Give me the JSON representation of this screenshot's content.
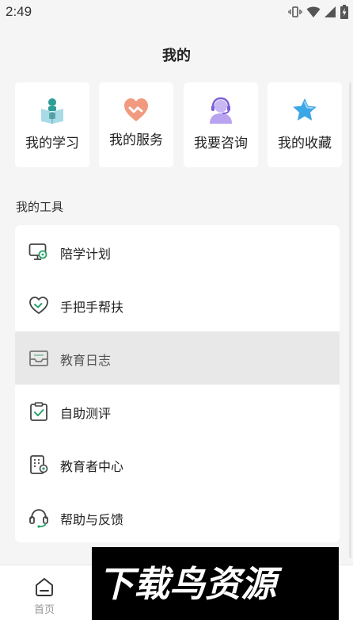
{
  "status_bar": {
    "time": "2:49",
    "icons": [
      "vibrate-icon",
      "wifi-icon",
      "signal-icon",
      "battery-charging-icon"
    ]
  },
  "page": {
    "title": "我的"
  },
  "shortcuts": [
    {
      "label": "我的学习",
      "icon": "reading-student-icon"
    },
    {
      "label": "我的服务",
      "icon": "heart-handshake-icon"
    },
    {
      "label": "我要咨询",
      "icon": "headset-advisor-icon"
    },
    {
      "label": "我的收藏",
      "icon": "star-icon"
    }
  ],
  "tools_section": {
    "title": "我的工具",
    "items": [
      {
        "label": "陪学计划",
        "icon": "monitor-gear-icon"
      },
      {
        "label": "手把手帮扶",
        "icon": "heart-hand-icon"
      },
      {
        "label": "教育日志",
        "icon": "inbox-icon",
        "highlighted": true
      },
      {
        "label": "自助测评",
        "icon": "clipboard-check-icon"
      },
      {
        "label": "教育者中心",
        "icon": "building-id-icon"
      },
      {
        "label": "帮助与反馈",
        "icon": "headset-icon"
      }
    ]
  },
  "bottom_nav": {
    "home_label": "首页",
    "home_icon": "home-icon"
  },
  "watermark": {
    "text": "下载鸟资源"
  },
  "colors": {
    "accent_green": "#2aa36a",
    "background": "#f5f5f5",
    "highlight_row": "#e8e8e8"
  }
}
